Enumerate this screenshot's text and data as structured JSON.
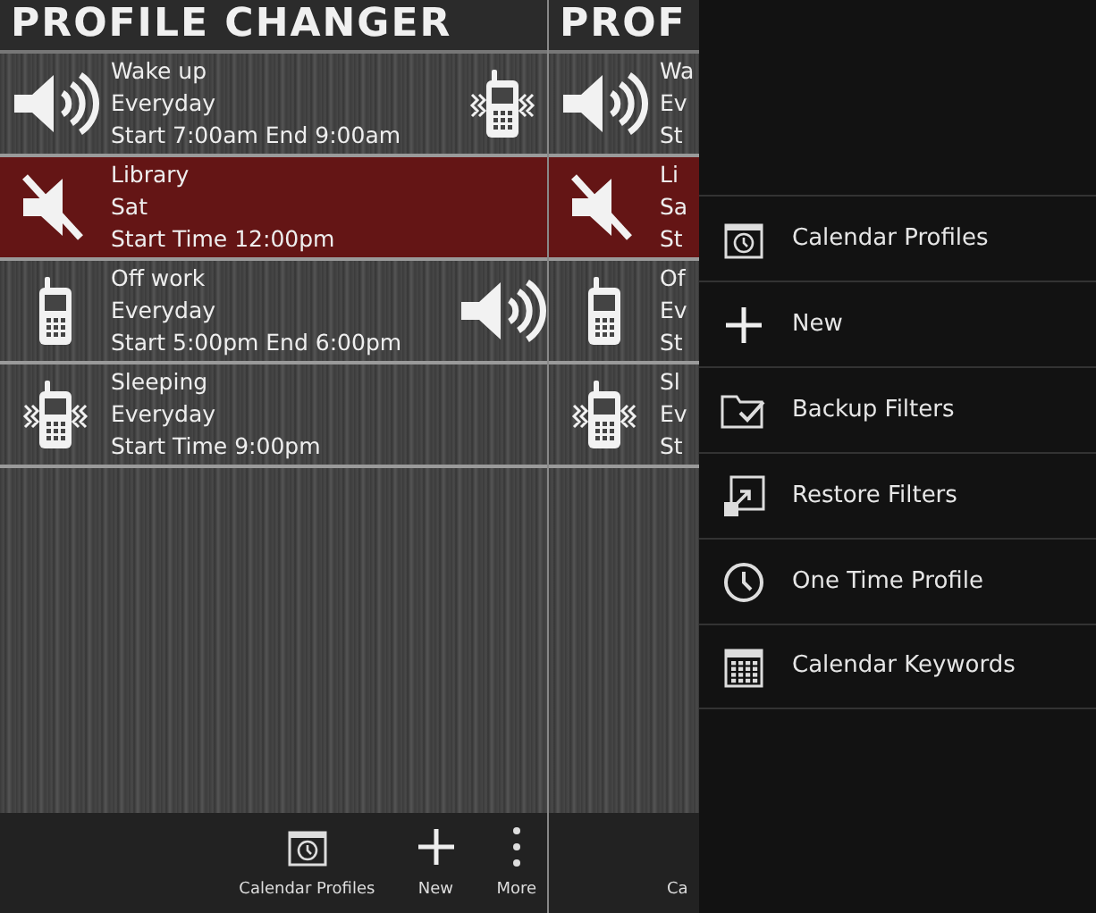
{
  "screens": [
    {
      "title": "PROFILE CHANGER",
      "profiles": [
        {
          "name": "Wake up",
          "days": "Everyday",
          "time": "Start 7:00am End 9:00am",
          "kind": "sound",
          "secondary": {
            "kind": "vibrate"
          },
          "selected": false
        },
        {
          "name": "Library",
          "days": "Sat",
          "time": "Start Time 12:00pm",
          "kind": "mute",
          "selected": true
        },
        {
          "name": "Off work",
          "days": "Everyday",
          "time": "Start 5:00pm End 6:00pm",
          "kind": "phone",
          "secondary": {
            "kind": "sound"
          },
          "selected": false
        },
        {
          "name": "Sleeping",
          "days": "Everyday",
          "time": "Start Time 9:00pm",
          "kind": "vibrate",
          "selected": false
        }
      ],
      "action_bar": [
        {
          "label": "Calendar Profiles",
          "kind": "calendar"
        },
        {
          "label": "New",
          "kind": "add"
        },
        {
          "label": "More",
          "kind": "more"
        }
      ]
    },
    {
      "title": "PROF",
      "profiles": [
        {
          "name": "Wa",
          "days": "Ev",
          "time": "St",
          "kind": "sound",
          "selected": false
        },
        {
          "name": "Li",
          "days": "Sa",
          "time": "St",
          "kind": "mute",
          "selected": true
        },
        {
          "name": "Of",
          "days": "Ev",
          "time": "St",
          "kind": "phone",
          "selected": false
        },
        {
          "name": "Sl",
          "days": "Ev",
          "time": "St",
          "kind": "vibrate",
          "selected": false
        }
      ],
      "action_bar": [
        {
          "label": "Ca"
        }
      ],
      "menu": [
        {
          "label": "Calendar Profiles",
          "kind": "calendar"
        },
        {
          "label": "New",
          "kind": "add"
        },
        {
          "label": "Backup Filters",
          "kind": "backup"
        },
        {
          "label": "Restore Filters",
          "kind": "restore"
        },
        {
          "label": "One Time Profile",
          "kind": "once"
        },
        {
          "label": "Calendar Keywords",
          "kind": "keywords"
        }
      ]
    }
  ]
}
